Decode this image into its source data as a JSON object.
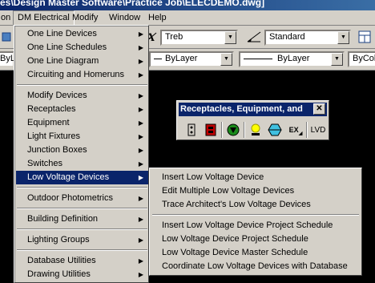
{
  "titlebar": {
    "text": "es\\Design Master Software\\Practice Job\\ELECDEMO.dwg]"
  },
  "menubar": {
    "items": [
      "on",
      "DM Electrical",
      "Modify",
      "Window",
      "Help"
    ]
  },
  "toolbar": {
    "text_style": "Treb",
    "dim_style": "Standard",
    "layer_left": "ByLa",
    "linetype": "ByLayer",
    "lineweight": "ByLayer",
    "color_right": "ByCol"
  },
  "dm_menu": {
    "items": [
      {
        "label": "One Line Devices",
        "submenu": true
      },
      {
        "label": "One Line Schedules",
        "submenu": true
      },
      {
        "label": "One Line Diagram",
        "submenu": true
      },
      {
        "label": "Circuiting and Homeruns",
        "submenu": true
      },
      {
        "label": "Modify Devices",
        "submenu": true
      },
      {
        "label": "Receptacles",
        "submenu": true
      },
      {
        "label": "Equipment",
        "submenu": true
      },
      {
        "label": "Light Fixtures",
        "submenu": true
      },
      {
        "label": "Junction Boxes",
        "submenu": true
      },
      {
        "label": "Switches",
        "submenu": true
      },
      {
        "label": "Low Voltage Devices",
        "submenu": true,
        "highlighted": true
      },
      {
        "label": "Outdoor Photometrics",
        "submenu": true
      },
      {
        "label": "Building Definition",
        "submenu": true
      },
      {
        "label": "Lighting Groups",
        "submenu": true
      },
      {
        "label": "Database Utilities",
        "submenu": true
      },
      {
        "label": "Drawing Utilities",
        "submenu": true
      }
    ],
    "submenu_arrow": "▶"
  },
  "low_voltage_submenu": {
    "items": [
      "Insert Low Voltage Device",
      "Edit Multiple Low Voltage Devices",
      "Trace Architect's Low Voltage Devices",
      "Insert Low Voltage Device Project Schedule",
      "Low Voltage Device Project Schedule",
      "Low Voltage Device Master Schedule",
      "Coordinate Low Voltage Devices with Database"
    ]
  },
  "floating_toolbar": {
    "title": "Receptacles, Equipment, and",
    "close": "✕",
    "ex_label": "EX",
    "lvd_label": "LVD"
  },
  "colors": {
    "highlight": "#0a246a",
    "face": "#d4d0c8",
    "canvas": "#000000"
  }
}
